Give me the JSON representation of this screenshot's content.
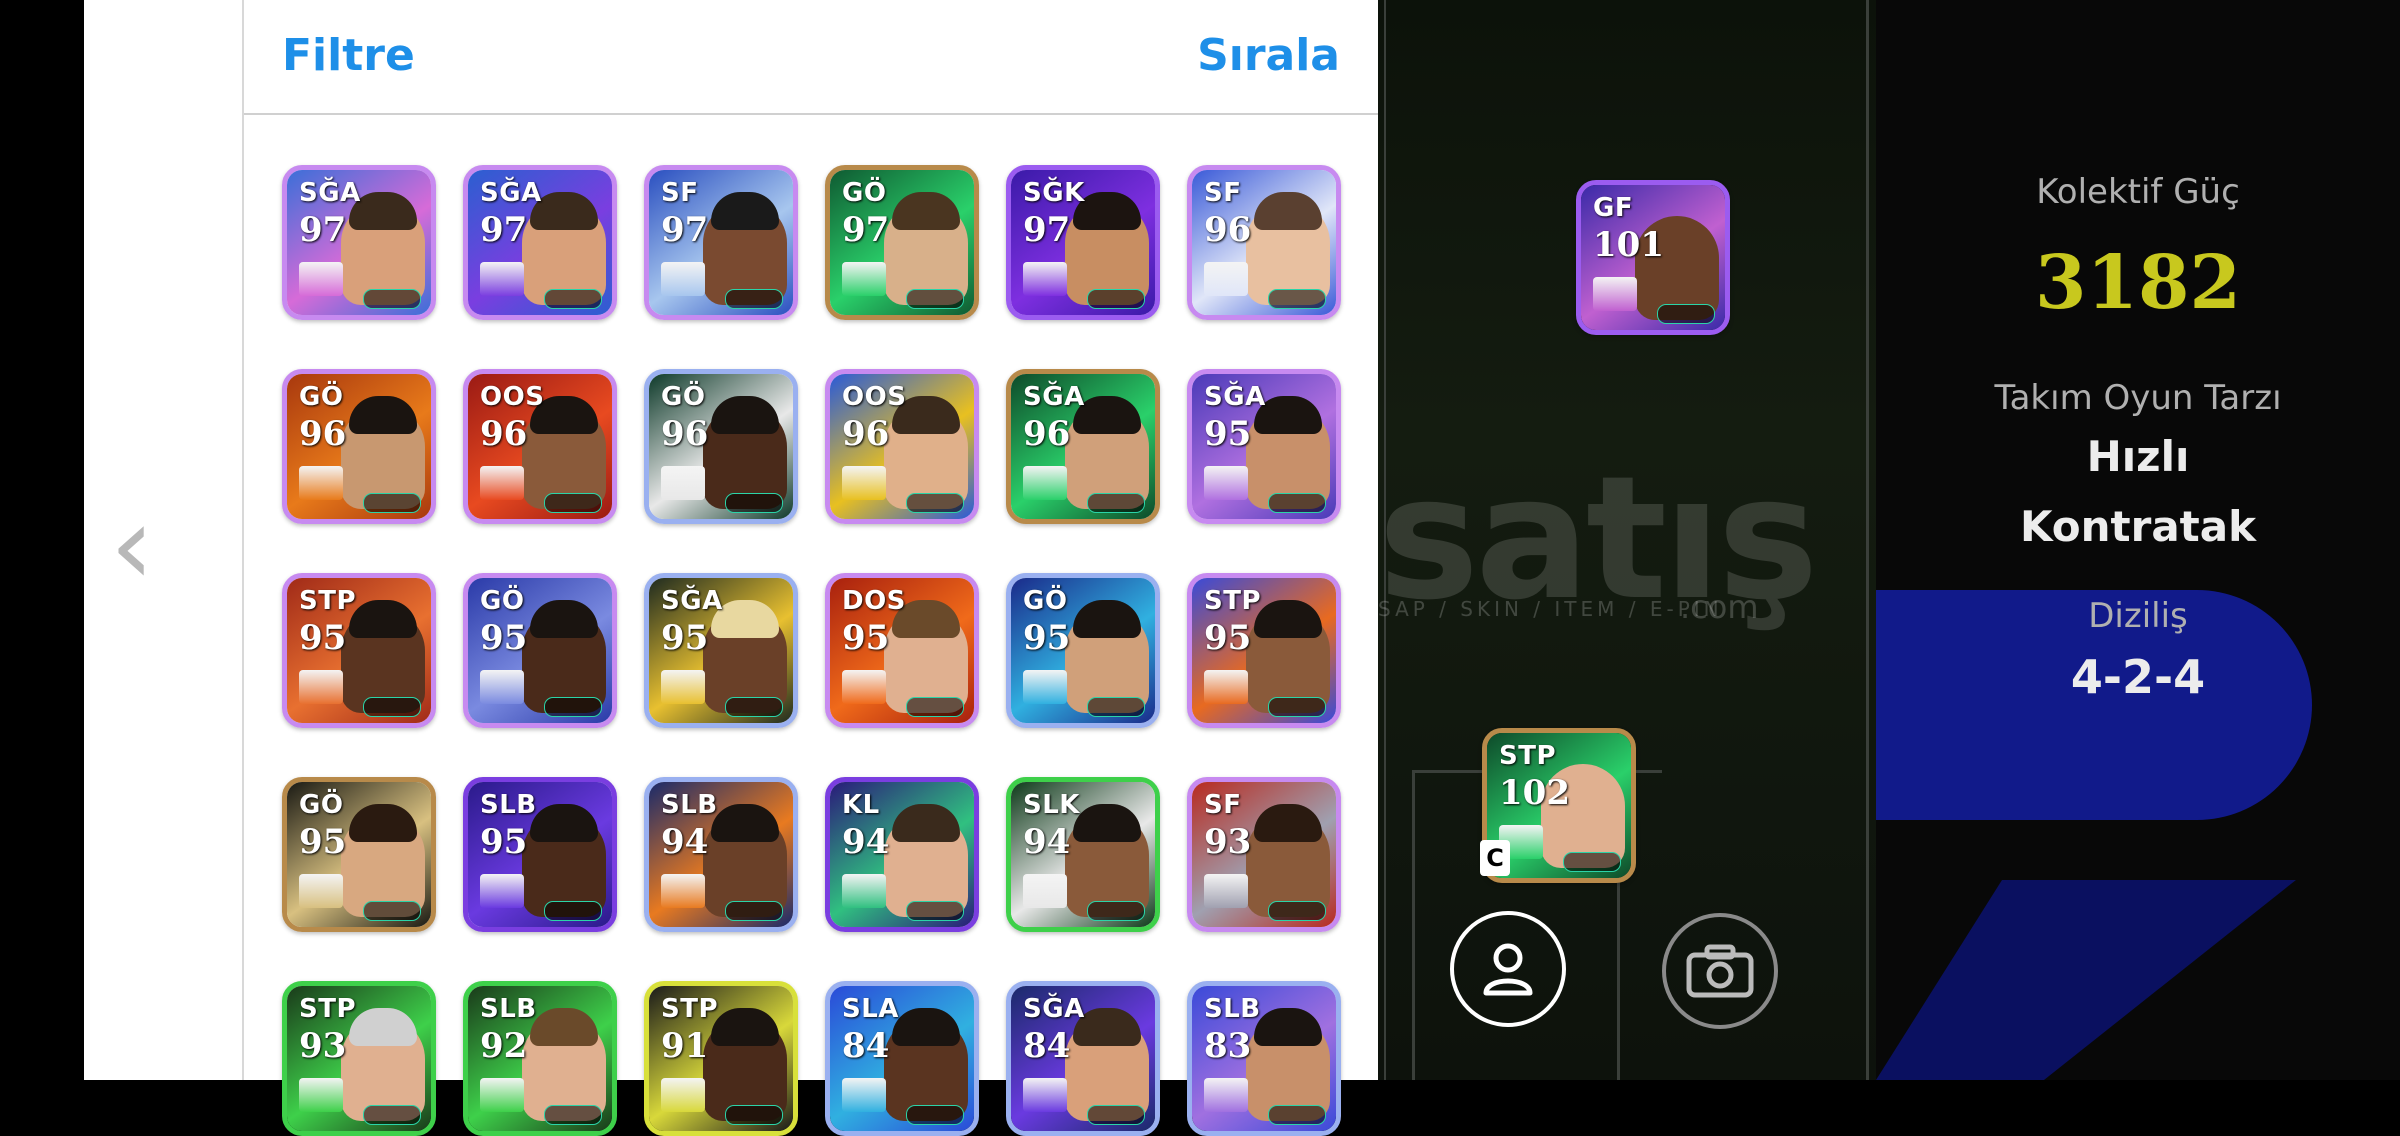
{
  "header": {
    "filter_label": "Filtre",
    "sort_label": "Sırala"
  },
  "cards": [
    {
      "pos": "SĞA",
      "ovr": "97",
      "bg": "#3b6fd8",
      "accent": "#d66bd8",
      "border": "#c78af0",
      "skin": "#d9a07a",
      "hair": "#3a2a1c"
    },
    {
      "pos": "SĞA",
      "ovr": "97",
      "bg": "#2b5fd0",
      "accent": "#7a3ee0",
      "border": "#c78af0",
      "skin": "#d9a07a",
      "hair": "#3a2a1c"
    },
    {
      "pos": "SF",
      "ovr": "97",
      "bg": "#2a4fc0",
      "accent": "#a7c6ee",
      "border": "#c78af0",
      "skin": "#7a4a30",
      "hair": "#1a1a1a"
    },
    {
      "pos": "GÖ",
      "ovr": "97",
      "bg": "#0f5a32",
      "accent": "#2ad06a",
      "border": "#b88a4a",
      "skin": "#d8b08a",
      "hair": "#4a3520"
    },
    {
      "pos": "SĞK",
      "ovr": "97",
      "bg": "#3a1aa8",
      "accent": "#7e2fe0",
      "border": "#9b5cf0",
      "skin": "#c88e62",
      "hair": "#1c1410"
    },
    {
      "pos": "SF",
      "ovr": "96",
      "bg": "#3a5ad8",
      "accent": "#e0e6f8",
      "border": "#c78af0",
      "skin": "#e8c0a0",
      "hair": "#5a4030"
    },
    {
      "pos": "GÖ",
      "ovr": "96",
      "bg": "#a8380e",
      "accent": "#e87a1a",
      "border": "#c78af0",
      "skin": "#c89870",
      "hair": "#1a1410"
    },
    {
      "pos": "OOS",
      "ovr": "96",
      "bg": "#9a1a14",
      "accent": "#e84a20",
      "border": "#c78af0",
      "skin": "#8a5a3a",
      "hair": "#1a1410"
    },
    {
      "pos": "GÖ",
      "ovr": "96",
      "bg": "#0e3a2a",
      "accent": "#e8e8e8",
      "border": "#9ab0f0",
      "skin": "#4a2a1a",
      "hair": "#1a1410"
    },
    {
      "pos": "OOS",
      "ovr": "96",
      "bg": "#2a5ad8",
      "accent": "#e8c020",
      "border": "#c78af0",
      "skin": "#e0b08a",
      "hair": "#3a2a1c"
    },
    {
      "pos": "SĞA",
      "ovr": "96",
      "bg": "#0e4a2a",
      "accent": "#2ad06a",
      "border": "#b88a4a",
      "skin": "#d0a07a",
      "hair": "#1a1410"
    },
    {
      "pos": "SĞA",
      "ovr": "95",
      "bg": "#4a3ab8",
      "accent": "#b070e0",
      "border": "#c78af0",
      "skin": "#c8906a",
      "hair": "#1a1410"
    },
    {
      "pos": "STP",
      "ovr": "95",
      "bg": "#a02a18",
      "accent": "#e87030",
      "border": "#c78af0",
      "skin": "#5a3420",
      "hair": "#1a1410"
    },
    {
      "pos": "GÖ",
      "ovr": "95",
      "bg": "#2a3aa8",
      "accent": "#7a8ae0",
      "border": "#c78af0",
      "skin": "#4a2a1a",
      "hair": "#1a1410"
    },
    {
      "pos": "SĞA",
      "ovr": "95",
      "bg": "#1e2a20",
      "accent": "#e8c030",
      "border": "#9ab0f0",
      "skin": "#6a4028",
      "hair": "#e8d8a0"
    },
    {
      "pos": "DOS",
      "ovr": "95",
      "bg": "#a8200e",
      "accent": "#f06a1a",
      "border": "#c78af0",
      "skin": "#e0b090",
      "hair": "#6a4a2a"
    },
    {
      "pos": "GÖ",
      "ovr": "95",
      "bg": "#1a2a8a",
      "accent": "#30b0e0",
      "border": "#9ab0f0",
      "skin": "#d0a07a",
      "hair": "#1a1410"
    },
    {
      "pos": "STP",
      "ovr": "95",
      "bg": "#3a4ad8",
      "accent": "#e86a20",
      "border": "#c78af0",
      "skin": "#8a5a3a",
      "hair": "#1a1410"
    },
    {
      "pos": "GÖ",
      "ovr": "95",
      "bg": "#1a1a14",
      "accent": "#d8c080",
      "border": "#b88a4a",
      "skin": "#d8a880",
      "hair": "#2a1a10"
    },
    {
      "pos": "SLB",
      "ovr": "95",
      "bg": "#2a1a8a",
      "accent": "#6a3ae0",
      "border": "#7a3ee0",
      "skin": "#4a2a1a",
      "hair": "#1a1410"
    },
    {
      "pos": "SLB",
      "ovr": "94",
      "bg": "#1a2a6a",
      "accent": "#e87a20",
      "border": "#9ab0f0",
      "skin": "#6a4028",
      "hair": "#1a1410"
    },
    {
      "pos": "KL",
      "ovr": "94",
      "bg": "#2a1a7a",
      "accent": "#30c080",
      "border": "#7a3ee0",
      "skin": "#e0b090",
      "hair": "#3a2a1c"
    },
    {
      "pos": "SLK",
      "ovr": "94",
      "bg": "#0e3a1a",
      "accent": "#e8e8e8",
      "border": "#3ed04a",
      "skin": "#8a5a3a",
      "hair": "#1a1410"
    },
    {
      "pos": "SF",
      "ovr": "93",
      "bg": "#b82a20",
      "accent": "#a0a0b0",
      "border": "#c78af0",
      "skin": "#8a5a3a",
      "hair": "#2a1a10"
    },
    {
      "pos": "STP",
      "ovr": "93",
      "bg": "#1a3a1a",
      "accent": "#3ed04a",
      "border": "#3ed04a",
      "skin": "#e0b090",
      "hair": "#d0d0d0"
    },
    {
      "pos": "SLB",
      "ovr": "92",
      "bg": "#1a3a1a",
      "accent": "#3ed04a",
      "border": "#3ed04a",
      "skin": "#e0b090",
      "hair": "#6a4a2a"
    },
    {
      "pos": "STP",
      "ovr": "91",
      "bg": "#1a1a1a",
      "accent": "#d8d83a",
      "border": "#d8e03a",
      "skin": "#4a2a1a",
      "hair": "#1a1410"
    },
    {
      "pos": "SLA",
      "ovr": "84",
      "bg": "#2a4ad8",
      "accent": "#30b0e0",
      "border": "#9ab0f0",
      "skin": "#5a3420",
      "hair": "#1a1410"
    },
    {
      "pos": "SĞA",
      "ovr": "84",
      "bg": "#1a2a6a",
      "accent": "#6a3ae0",
      "border": "#9ab0f0",
      "skin": "#d9a07a",
      "hair": "#3a2a1c"
    },
    {
      "pos": "SLB",
      "ovr": "83",
      "bg": "#3a4ad8",
      "accent": "#a070e0",
      "border": "#9ab0f0",
      "skin": "#c8906a",
      "hair": "#1a1410"
    }
  ],
  "pitch_cards": [
    {
      "pos": "GF",
      "ovr": "101",
      "bg": "#3a2aa8",
      "accent": "#c060d0",
      "border": "#9b5cf0",
      "skin": "#6a4028"
    },
    {
      "pos": "STP",
      "ovr": "102",
      "bg": "#0e4a2a",
      "accent": "#2ad06a",
      "border": "#b88a4a",
      "skin": "#e0b090"
    }
  ],
  "pitch_tag": "C",
  "watermark": {
    "main": "satış",
    "sub": "SAP / SKIN / ITEM / E-PIN",
    "com": ".com"
  },
  "stats": {
    "collective_label": "Kolektif Güç",
    "collective_value": "3182",
    "playstyle_label": "Takım Oyun Tarzı",
    "playstyle_line1": "Hızlı",
    "playstyle_line2": "Kontratak",
    "formation_label": "Diziliş",
    "formation_value": "4-2-4"
  },
  "colors": {
    "accent_blue": "#1e8fe8",
    "collective_gold": "#c8c81e",
    "formation_pill": "#111a8a"
  }
}
